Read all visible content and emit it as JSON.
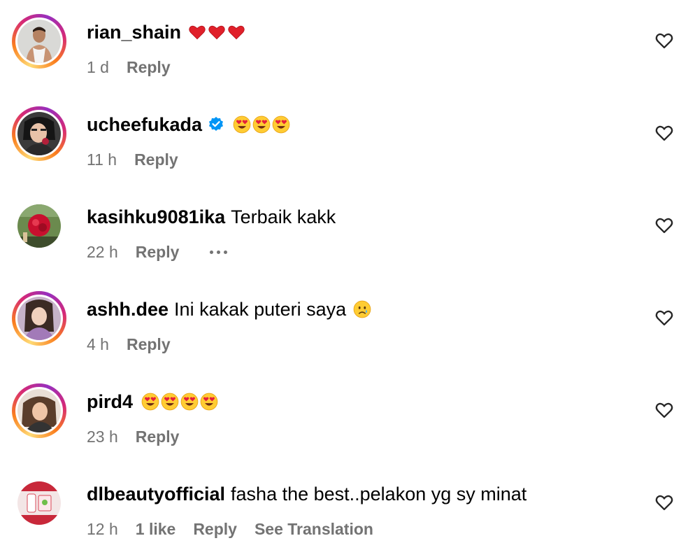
{
  "comments": [
    {
      "username": "rian_shain",
      "text": "",
      "emojis": [
        "heart",
        "heart",
        "heart"
      ],
      "verified": false,
      "time": "1 d",
      "likes": "",
      "reply_label": "Reply",
      "translation_label": "",
      "story_ring": true,
      "show_more": false
    },
    {
      "username": "ucheefukada",
      "text": "",
      "emojis": [
        "heart-eyes",
        "heart-eyes",
        "heart-eyes"
      ],
      "verified": true,
      "time": "11 h",
      "likes": "",
      "reply_label": "Reply",
      "translation_label": "",
      "story_ring": true,
      "show_more": false
    },
    {
      "username": "kasihku9081ika",
      "text": "Terbaik kakk",
      "emojis": [],
      "verified": false,
      "time": "22 h",
      "likes": "",
      "reply_label": "Reply",
      "translation_label": "",
      "story_ring": false,
      "show_more": true
    },
    {
      "username": "ashh.dee",
      "text": "Ini kakak puteri saya",
      "emojis": [
        "crying-face"
      ],
      "verified": false,
      "time": "4 h",
      "likes": "",
      "reply_label": "Reply",
      "translation_label": "",
      "story_ring": true,
      "show_more": false
    },
    {
      "username": "pird4",
      "text": "",
      "emojis": [
        "heart-eyes",
        "heart-eyes",
        "heart-eyes",
        "heart-eyes"
      ],
      "verified": false,
      "time": "23 h",
      "likes": "",
      "reply_label": "Reply",
      "translation_label": "",
      "story_ring": true,
      "show_more": false
    },
    {
      "username": "dlbeautyofficial",
      "text": "fasha the best..pelakon yg sy minat",
      "emojis": [],
      "verified": false,
      "time": "12 h",
      "likes": "1 like",
      "reply_label": "Reply",
      "translation_label": "See Translation",
      "story_ring": false,
      "show_more": false
    }
  ],
  "icons": {
    "like": "heart-outline-icon",
    "verified": "verified-badge-icon",
    "more": "more-horizontal-icon"
  },
  "colors": {
    "meta": "#737373",
    "verified": "#0095f6",
    "ring_start": "#feda75",
    "ring_end": "#962fbf"
  }
}
